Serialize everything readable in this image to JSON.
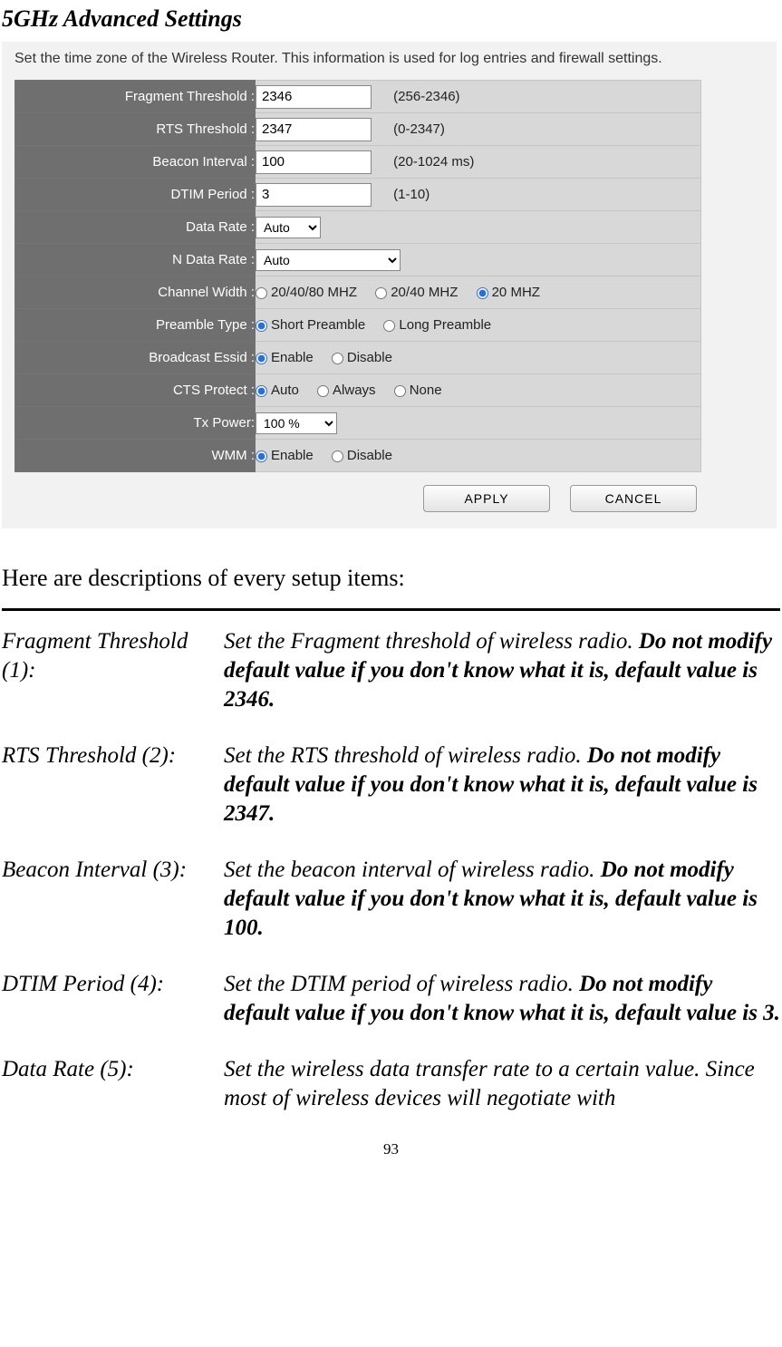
{
  "title": "5GHz Advanced Settings",
  "panel": {
    "caption": "Set the time zone of the Wireless Router. This information is used for log entries and firewall settings.",
    "rows": {
      "fragment": {
        "label": "Fragment Threshold :",
        "value": "2346",
        "hint": "(256-2346)"
      },
      "rts": {
        "label": "RTS Threshold :",
        "value": "2347",
        "hint": "(0-2347)"
      },
      "beacon": {
        "label": "Beacon Interval :",
        "value": "100",
        "hint": "(20-1024 ms)"
      },
      "dtim": {
        "label": "DTIM Period :",
        "value": "3",
        "hint": "(1-10)"
      },
      "data_rate": {
        "label": "Data Rate :",
        "select": "Auto"
      },
      "n_rate": {
        "label": "N Data Rate :",
        "select": "Auto"
      },
      "chwidth": {
        "label": "Channel Width :",
        "opts": [
          "20/40/80 MHZ",
          "20/40 MHZ",
          "20 MHZ"
        ],
        "selected": "20 MHZ"
      },
      "preamble": {
        "label": "Preamble Type :",
        "opts": [
          "Short Preamble",
          "Long Preamble"
        ],
        "selected": "Short Preamble"
      },
      "bcast": {
        "label": "Broadcast Essid :",
        "opts": [
          "Enable",
          "Disable"
        ],
        "selected": "Enable"
      },
      "cts": {
        "label": "CTS Protect :",
        "opts": [
          "Auto",
          "Always",
          "None"
        ],
        "selected": "Auto"
      },
      "txp": {
        "label": "Tx Power:",
        "select": "100 %"
      },
      "wmm": {
        "label": "WMM :",
        "opts": [
          "Enable",
          "Disable"
        ],
        "selected": "Enable"
      }
    },
    "apply": "APPLY",
    "cancel": "CANCEL"
  },
  "intro": "Here are descriptions of every setup items:",
  "descriptions": [
    {
      "term": "Fragment Threshold (1):",
      "plain": "Set the Fragment threshold of wireless radio.    ",
      "bold": "Do not modify default value if you don't know what it is, default value is 2346."
    },
    {
      "term": "RTS Threshold (2):",
      "plain": "Set the RTS threshold of wireless radio. ",
      "bold": "Do not modify default value if you don't know what it is, default value is 2347."
    },
    {
      "term": "Beacon Interval (3):",
      "plain": "Set the beacon interval of wireless radio. ",
      "bold": "Do not modify default value if you don't know what it is, default value is 100."
    },
    {
      "term": "DTIM Period (4):",
      "plain": "Set the DTIM period of wireless radio. ",
      "bold": "Do not modify default value if you don't know what it is, default value is 3."
    },
    {
      "term": "Data Rate (5):",
      "plain": "Set the wireless data transfer rate to a certain value. Since most of wireless devices will negotiate with",
      "bold": ""
    }
  ],
  "page": "93"
}
